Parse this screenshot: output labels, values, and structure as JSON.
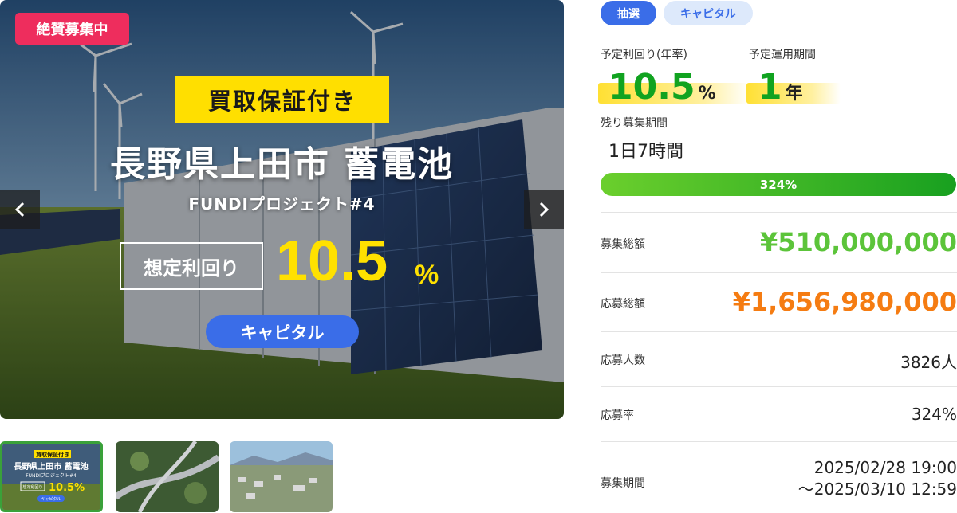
{
  "hero": {
    "status_badge": "絶賛募集中",
    "buyback_badge": "買取保証付き",
    "title": "長野県上田市 蓄電池",
    "subtitle": "FUNDIプロジェクト#4",
    "yield_label": "想定利回り",
    "yield_value": "10.5",
    "yield_unit": "%",
    "category_pill": "キャピタル"
  },
  "tags": [
    "抽選",
    "キャピタル"
  ],
  "stats": {
    "yield_label": "予定利回り(年率)",
    "yield_value": "10.5",
    "yield_unit": "%",
    "term_label": "予定運用期間",
    "term_value": "1",
    "term_unit": "年",
    "remaining_label": "残り募集期間",
    "remaining_value": "1日7時間",
    "progress_text": "324%",
    "progress_fraction": 1.0
  },
  "rows": [
    {
      "label": "募集総額",
      "value": "¥510,000,000"
    },
    {
      "label": "応募総額",
      "value": "¥1,656,980,000"
    },
    {
      "label": "応募人数",
      "value": "3826人"
    },
    {
      "label": "応募率",
      "value": "324%"
    },
    {
      "label": "募集期間",
      "value_line1": "2025/02/28 19:00",
      "value_line2": "～2025/03/10 12:59"
    }
  ],
  "thumb1": {
    "badge": "買取保証付き",
    "title": "長野県上田市 蓄電池",
    "subtitle": "FUNDIプロジェクト#4",
    "yield_label": "想定利回り",
    "yield": "10.5%",
    "pill": "キャピタル"
  },
  "colors": {
    "accent_blue": "#3a6de8",
    "green": "#11a320",
    "orange": "#f57c12",
    "badge_red": "#ee2d5d",
    "yellow": "#ffdf00"
  },
  "icons": {
    "prev": "chevron-left-icon",
    "next": "chevron-right-icon"
  }
}
